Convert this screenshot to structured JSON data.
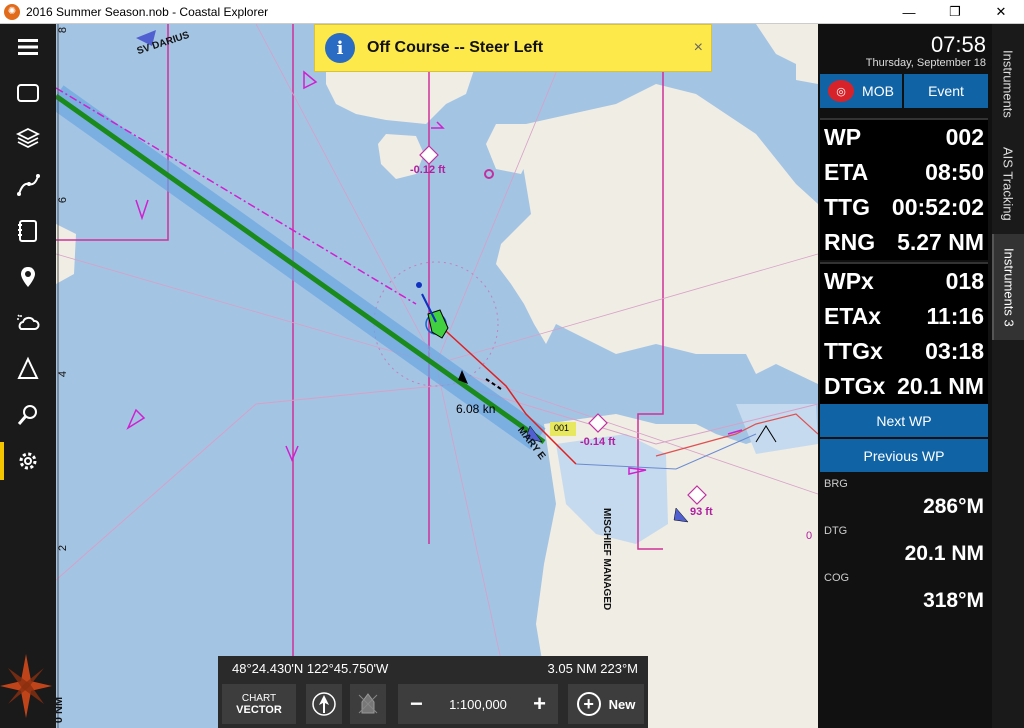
{
  "window": {
    "title": "2016 Summer Season.nob - Coastal Explorer",
    "minimize": "—",
    "maximize": "❐",
    "close": "✕"
  },
  "left_toolbar": [
    {
      "name": "menu-icon"
    },
    {
      "name": "page-icon"
    },
    {
      "name": "layers-icon"
    },
    {
      "name": "route-icon"
    },
    {
      "name": "logbook-icon"
    },
    {
      "name": "pin-icon"
    },
    {
      "name": "weather-icon"
    },
    {
      "name": "tide-icon"
    },
    {
      "name": "search-icon"
    },
    {
      "name": "settings-icon"
    }
  ],
  "alert": {
    "text": "Off Course -- Steer Left",
    "icon": "i",
    "close": "×"
  },
  "chart_labels": {
    "vessel1": "SV DARIUS",
    "vessel2": "MARY E",
    "vessel3": "MISCHIEF MANAGED",
    "depth1": "-0.12 ft",
    "depth2": "-0.14 ft",
    "depth3": "93 ft",
    "speed": "6.08 kn",
    "waypoint": "001",
    "scale_marks": [
      "8",
      "6",
      "4",
      "2",
      "0 NM"
    ],
    "edge_label": "0"
  },
  "status": {
    "position": "48°24.430'N  122°45.750'W",
    "range_bearing": "3.05 NM  223°M"
  },
  "bottom_bar": {
    "chart_label": "CHART",
    "vector_label": "VECTOR",
    "scale": "1:100,000",
    "minus": "−",
    "plus": "+",
    "new_label": "New"
  },
  "panel": {
    "time": "07:58",
    "date": "Thursday, September 18",
    "mob_label": "MOB",
    "event_label": "Event",
    "group1": [
      {
        "label": "WP",
        "value": "002"
      },
      {
        "label": "ETA",
        "value": "08:50"
      },
      {
        "label": "TTG",
        "value": "00:52:02"
      },
      {
        "label": "RNG",
        "value": "5.27 NM"
      }
    ],
    "group2": [
      {
        "label": "WPx",
        "value": "018"
      },
      {
        "label": "ETAx",
        "value": "11:16"
      },
      {
        "label": "TTGx",
        "value": "03:18"
      },
      {
        "label": "DTGx",
        "value": "20.1 NM"
      }
    ],
    "next_wp": "Next WP",
    "previous_wp": "Previous WP",
    "brg": {
      "label": "BRG",
      "value": "286°M"
    },
    "dtg": {
      "label": "DTG",
      "value": "20.1 NM"
    },
    "cog": {
      "label": "COG",
      "value": "318°M"
    }
  },
  "tabs": [
    "Instruments",
    "AIS Tracking",
    "Instruments 3"
  ],
  "colors": {
    "accent": "#f2c500",
    "button": "#1064a6",
    "water": "#a4c4e4",
    "land": "#f0ede4",
    "track": "#1a8a1a"
  }
}
